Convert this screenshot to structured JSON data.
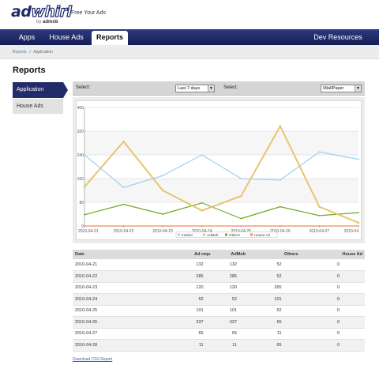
{
  "brand": {
    "logo_ad": "ad",
    "logo_whirl": "whirl",
    "by": "by",
    "by_company": "admob",
    "tagline": "Free Your Ads"
  },
  "nav": {
    "items": [
      {
        "label": "Apps"
      },
      {
        "label": "House Ads"
      },
      {
        "label": "Reports"
      }
    ],
    "right_label": "Dev Resources",
    "active": "Reports"
  },
  "breadcrumb": {
    "items": [
      "Reports",
      "Application"
    ]
  },
  "page_title": "Reports",
  "sidebar": {
    "items": [
      {
        "label": "Application",
        "active": true
      },
      {
        "label": "House Ads",
        "active": false
      }
    ]
  },
  "filters": {
    "select1_label": "Select:",
    "range_value": "Last 7 days",
    "select2_label": "Select:",
    "app_value": "iWallPaper"
  },
  "chart_data": {
    "type": "line",
    "x": [
      "2010-04-21",
      "2010-04-22",
      "2010-04-23",
      "2010-04-24",
      "2010-04-25",
      "2010-04-26",
      "2010-04-27",
      "2010-04-28"
    ],
    "x_tick_labels": [
      "2010-04-21",
      "2010-04-22",
      "2010-04-23",
      "2010-04-24",
      "2010-04-25",
      "2010-04-26",
      "2010-04-27",
      "2010-04"
    ],
    "ylim": [
      0,
      400
    ],
    "yticks": [
      0,
      80,
      160,
      240,
      320,
      400
    ],
    "grid": true,
    "legend_position": "bottom",
    "series": [
      {
        "name": "InMobi",
        "color": "#9fd0ef",
        "values": [
          240,
          130,
          170,
          240,
          160,
          155,
          250,
          225
        ]
      },
      {
        "name": "AdMob",
        "color": "#e8c470",
        "values": [
          132,
          285,
          120,
          52,
          101,
          337,
          65,
          11
        ]
      },
      {
        "name": "Others",
        "color": "#6fa91f",
        "values": [
          38,
          73,
          40,
          78,
          25,
          65,
          35,
          45
        ]
      },
      {
        "name": "House Ad",
        "color": "#f08a55",
        "values": [
          0,
          0,
          0,
          0,
          0,
          0,
          0,
          0
        ]
      }
    ]
  },
  "table": {
    "headers": [
      "Date",
      "Ad reqs",
      "AdMob",
      "Others",
      "House Ad"
    ],
    "rows": [
      [
        "2010-04-21",
        "132",
        "132",
        "52",
        "0"
      ],
      [
        "2010-04-22",
        "285",
        "285",
        "52",
        "0"
      ],
      [
        "2010-04-23",
        "120",
        "120",
        "265",
        "0"
      ],
      [
        "2010-04-24",
        "52",
        "52",
        "101",
        "0"
      ],
      [
        "2010-04-25",
        "101",
        "101",
        "52",
        "0"
      ],
      [
        "2010-04-26",
        "337",
        "337",
        "65",
        "0"
      ],
      [
        "2010-04-27",
        "65",
        "65",
        "11",
        "0"
      ],
      [
        "2010-04-28",
        "11",
        "11",
        "65",
        "0"
      ]
    ]
  },
  "csv_link": "Download CSV Report"
}
